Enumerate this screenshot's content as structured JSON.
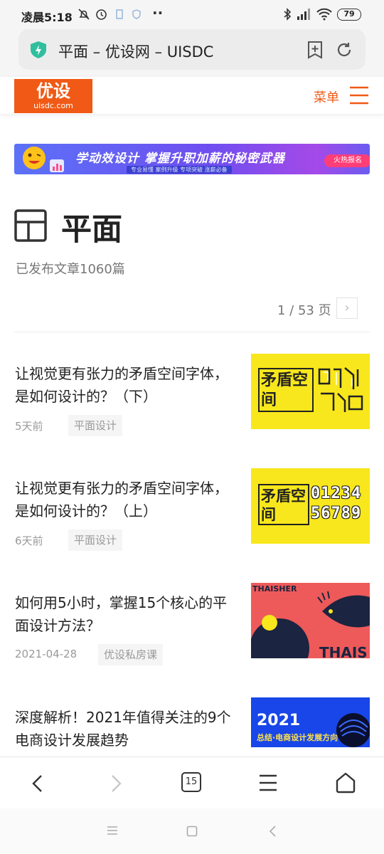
{
  "status_bar": {
    "time": "凌晨5:18",
    "battery": "79",
    "icons": [
      "bell-off-icon",
      "alarm-icon",
      "notification-icon",
      "shield-icon",
      "more-dots-icon",
      "bluetooth-icon",
      "signal-icon",
      "wifi-icon",
      "battery-icon"
    ]
  },
  "browser": {
    "page_title": "平面 – 优设网 – UISDC",
    "tab_count": "15"
  },
  "site": {
    "logo_cn": "优设",
    "logo_en": "uisdc.com",
    "menu_label": "菜单",
    "brand_color": "#f05a16"
  },
  "banner": {
    "headline": "学动效设计 掌握升职加薪的秘密武器",
    "tags": "专业易懂  案例升级  专项突破  涨薪必备",
    "cta": "火热报名"
  },
  "category": {
    "title": "平面",
    "count_text": "已发布文章1060篇",
    "pager_text": "1 / 53 页"
  },
  "articles": [
    {
      "title": "让视觉更有张力的矛盾空间字体，是如何设计的？（下）",
      "time": "5天前",
      "tag": "平面设计",
      "thumb_text": "矛盾空间"
    },
    {
      "title": "让视觉更有张力的矛盾空间字体，是如何设计的？（上）",
      "time": "6天前",
      "tag": "平面设计",
      "thumb_text": "矛盾空间",
      "thumb_digits": "01234 56789"
    },
    {
      "title": "如何用5小时，掌握15个核心的平面设计方法？",
      "time": "2021-04-28",
      "tag": "优设私房课",
      "thumb_text": "THAISHER",
      "thumb_text2": "THAIS"
    },
    {
      "title": "深度解析！2021年值得关注的9个电商设计发展趋势",
      "time": "",
      "tag": "",
      "thumb_text": "2021",
      "thumb_text2": "总结·电商设计发展方向"
    }
  ]
}
